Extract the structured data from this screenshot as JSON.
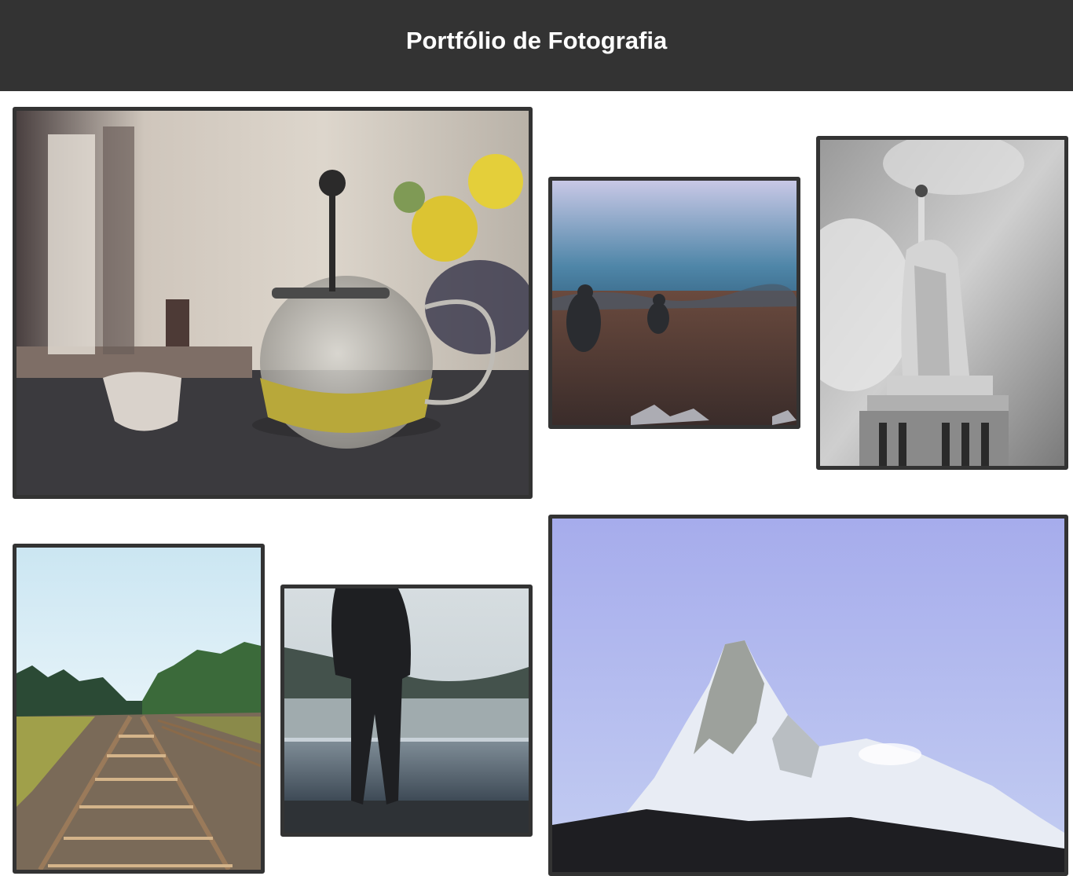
{
  "header": {
    "title": "Portfólio de Fotografia"
  },
  "colors": {
    "header_bg": "#333333",
    "header_text": "#ffffff",
    "frame": "#333333",
    "page_bg": "#ffffff"
  },
  "gallery": {
    "photos": [
      {
        "subject": "teapot"
      },
      {
        "subject": "misty-field"
      },
      {
        "subject": "statue-of-liberty"
      },
      {
        "subject": "railway-tracks"
      },
      {
        "subject": "man-at-lake"
      },
      {
        "subject": "matterhorn"
      }
    ]
  }
}
